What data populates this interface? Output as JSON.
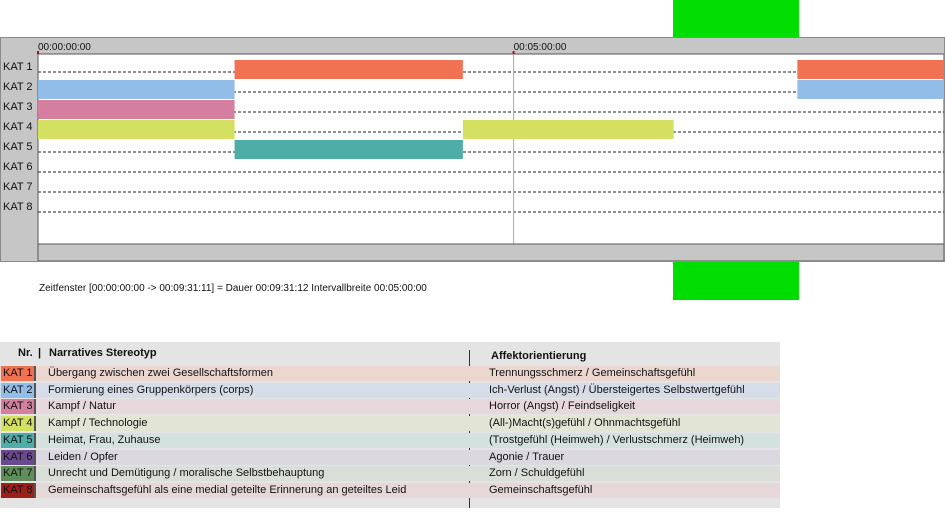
{
  "chart_data": {
    "type": "timeline",
    "time_axis": {
      "start": "00:00:00:00",
      "end": "00:09:31:11",
      "range_seconds": [
        0,
        571.5
      ],
      "ticks": [
        {
          "label": "00:00:00:00",
          "seconds": 0
        },
        {
          "label": "00:05:00:00",
          "seconds": 300
        }
      ]
    },
    "categories": [
      "KAT 1",
      "KAT 2",
      "KAT 3",
      "KAT 4",
      "KAT 5",
      "KAT 6",
      "KAT 7",
      "KAT 8"
    ],
    "category_colors": [
      "#f07252",
      "#93bde9",
      "#d47f9f",
      "#d3e062",
      "#4fada7",
      "#6a4a8e",
      "#5f8e5a",
      "#9c2018"
    ],
    "segments": [
      {
        "category": "KAT 1",
        "start": 124,
        "end": 268
      },
      {
        "category": "KAT 1",
        "start": 479,
        "end": 571.5
      },
      {
        "category": "KAT 2",
        "start": 0,
        "end": 124
      },
      {
        "category": "KAT 2",
        "start": 479,
        "end": 571.5
      },
      {
        "category": "KAT 3",
        "start": 0,
        "end": 124
      },
      {
        "category": "KAT 4",
        "start": 0,
        "end": 124
      },
      {
        "category": "KAT 4",
        "start": 268,
        "end": 401
      },
      {
        "category": "KAT 5",
        "start": 124,
        "end": 268
      }
    ],
    "cursor_seconds": 300,
    "footer_text": "Zeitfenster [00:00:00:00 -> 00:09:31:11] = Dauer 00:09:31:12     Intervallbreite 00:05:00:00"
  },
  "legend": {
    "header_nr": "Nr.",
    "header_stereotype": "Narratives Stereotyp",
    "header_affect": "Affektorientierung",
    "rows": [
      {
        "code": "KAT 1",
        "name": "Übergang zwischen zwei Gesellschaftsformen",
        "affect": "Trennungsschmerz / Gemeinschaftsgefühl",
        "band": "#ebd6d0"
      },
      {
        "code": "KAT 2",
        "name": "Formierung eines Gruppenkörpers (corps)",
        "affect": "Ich-Verlust (Angst) / Übersteigertes Selbstwertgefühl",
        "band": "#d6dde8"
      },
      {
        "code": "KAT 3",
        "name": "Kampf / Natur",
        "affect": "Horror (Angst) / Feindseligkeit",
        "band": "#e6d8dc"
      },
      {
        "code": "KAT 4",
        "name": "Kampf / Technologie",
        "affect": "(All-)Macht(s)gefühl / Ohnmachtsgefühl",
        "band": "#e2e4d4"
      },
      {
        "code": "KAT 5",
        "name": "Heimat, Frau, Zuhause",
        "affect": "(Trostgefühl (Heimweh) / Verlustschmerz (Heimweh)",
        "band": "#d3e1df"
      },
      {
        "code": "KAT 6",
        "name": "Leiden / Opfer",
        "affect": "Agonie / Trauer",
        "band": "#dbd8e0"
      },
      {
        "code": "KAT 7",
        "name": "Unrecht und Demütigung / moralische Selbstbehauptung",
        "affect": "Zorn / Schuldgefühl",
        "band": "#d9dfd8"
      },
      {
        "code": "KAT 8",
        "name": "Gemeinschaftsgefühl als eine medial geteilte Erinnerung an geteiltes Leid",
        "affect": "Gemeinschaftsgefühl",
        "band": "#e6d8d8"
      }
    ]
  }
}
